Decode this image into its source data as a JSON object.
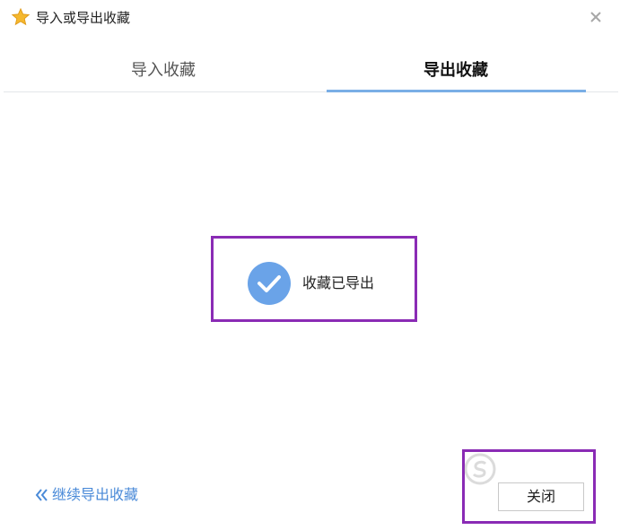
{
  "window": {
    "title": "导入或导出收藏",
    "title_icon": "star-icon",
    "close_icon": "close-icon"
  },
  "tabs": [
    {
      "label": "导入收藏",
      "active": false
    },
    {
      "label": "导出收藏",
      "active": true
    }
  ],
  "status": {
    "icon": "check-circle-icon",
    "message": "收藏已导出"
  },
  "footer": {
    "continue_icon": "double-chevron-left-icon",
    "continue_label": "继续导出收藏",
    "close_label": "关闭"
  },
  "colors": {
    "accent": "#7aaee6",
    "link": "#4a8ad8",
    "check": "#6aa3e8",
    "highlight": "#8a2bb5",
    "star": "#f5b82e"
  }
}
